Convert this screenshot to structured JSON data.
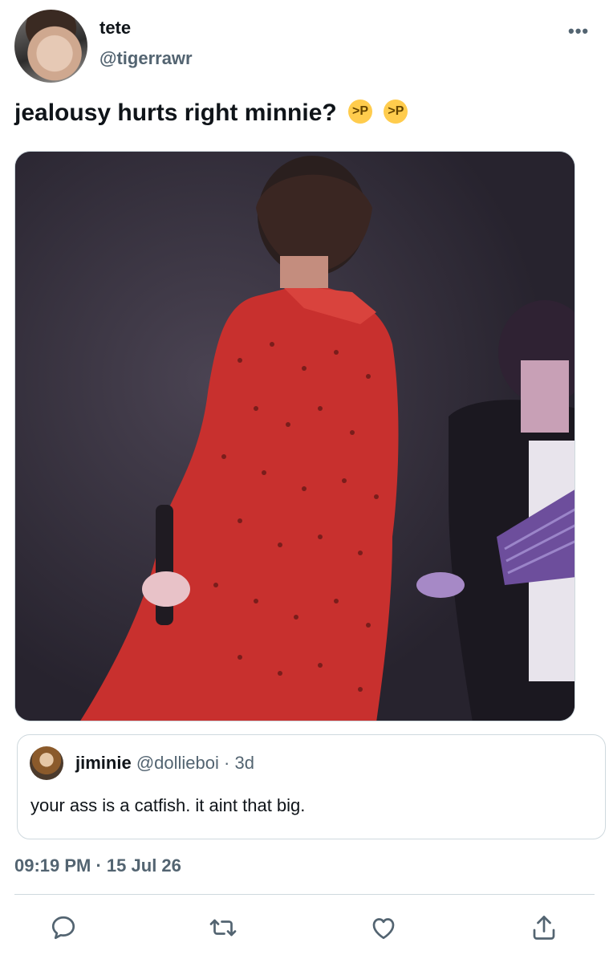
{
  "tweet": {
    "author": {
      "display_name": "tete",
      "handle": "@tigerrawr"
    },
    "more_label": "•••",
    "text": "jealousy hurts right minnie?",
    "emojis": [
      "😝",
      "😝"
    ],
    "quoted": {
      "display_name": "jiminie",
      "handle": "@dollieboi",
      "separator": "·",
      "time": "3d",
      "text": "your ass is a catfish. it aint that big."
    },
    "timestamp": "09:19 PM · 15 Jul 26"
  },
  "actions": {
    "icons": [
      "reply-icon",
      "retweet-icon",
      "like-icon",
      "share-icon"
    ]
  },
  "colors": {
    "text": "#0f1419",
    "secondary": "#536471",
    "border": "#cfd9de"
  }
}
